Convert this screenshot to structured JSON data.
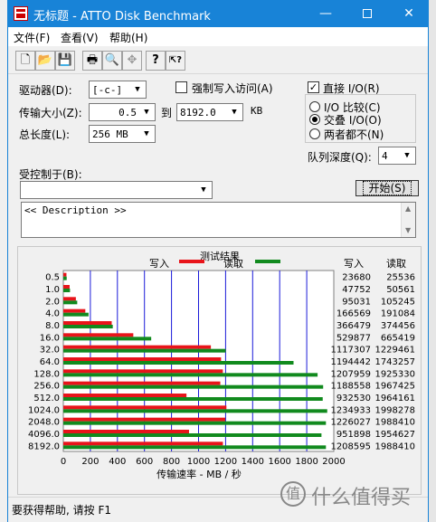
{
  "window": {
    "title": "无标题 - ATTO Disk Benchmark",
    "minimize": "—",
    "maximize": "",
    "close": "✕"
  },
  "menu": [
    "文件(F)",
    "查看(V)",
    "帮助(H)"
  ],
  "toolbar": [
    {
      "name": "new-icon",
      "glyph": "🗋"
    },
    {
      "name": "open-icon",
      "glyph": "📂"
    },
    {
      "name": "save-icon",
      "glyph": "💾"
    },
    {
      "name": "print-icon",
      "glyph": "🖶"
    },
    {
      "name": "print-preview-icon",
      "glyph": "🔍"
    },
    {
      "name": "move-icon",
      "glyph": "✥"
    },
    {
      "name": "help-icon",
      "glyph": "?"
    },
    {
      "name": "context-help-icon",
      "glyph": "⇱?"
    }
  ],
  "form": {
    "drive_label": "驱动器(D):",
    "drive_value": "[-c-]",
    "force_write_label": "强制写入访问(A)",
    "transfer_label": "传输大小(Z):",
    "transfer_from": "0.5",
    "to_label": "到",
    "transfer_to": "8192.0",
    "kb_label": "KB",
    "total_label": "总长度(L):",
    "total_value": "256 MB",
    "direct_io_label": "直接 I/O(R)",
    "io_compare_label": "I/O 比较(C)",
    "overlapped_io_label": "交叠 I/O(O)",
    "neither_label": "两者都不(N)",
    "queue_label": "队列深度(Q):",
    "queue_value": "4",
    "controlled_by_label": "受控制于(B):",
    "controlled_by_value": "",
    "start_button": "开始(S)",
    "description": "<< Description >>"
  },
  "chart_data": {
    "type": "bar",
    "title": "测试结果",
    "legend": [
      {
        "name": "写入",
        "color": "#e8141a"
      },
      {
        "name": "读取",
        "color": "#118a1e"
      }
    ],
    "xlabel": "传输速率 - MB / 秒",
    "xlim": [
      0,
      2000
    ],
    "xticks": [
      "0",
      "200",
      "400",
      "600",
      "800",
      "1000",
      "1200",
      "1400",
      "1600",
      "1800",
      "2000"
    ],
    "col_headers": [
      "写入",
      "读取"
    ],
    "categories": [
      "0.5",
      "1.0",
      "2.0",
      "4.0",
      "8.0",
      "16.0",
      "32.0",
      "64.0",
      "128.0",
      "256.0",
      "512.0",
      "1024.0",
      "2048.0",
      "4096.0",
      "8192.0"
    ],
    "series": [
      {
        "name": "写入",
        "values": [
          23680,
          47752,
          95031,
          166569,
          366479,
          529877,
          1117307,
          1194442,
          1207959,
          1188558,
          932530,
          1234933,
          1226027,
          951898,
          1208595
        ]
      },
      {
        "name": "读取",
        "values": [
          25536,
          50561,
          105245,
          191084,
          374456,
          665419,
          1229461,
          1743257,
          1925330,
          1967425,
          1964161,
          1998278,
          1988410,
          1954627,
          1988410
        ]
      }
    ],
    "value_unit_divisor": 1024
  },
  "status": {
    "text": "要获得帮助, 请按 F1"
  },
  "watermark": {
    "text": "什么值得买",
    "glyph": "值"
  }
}
